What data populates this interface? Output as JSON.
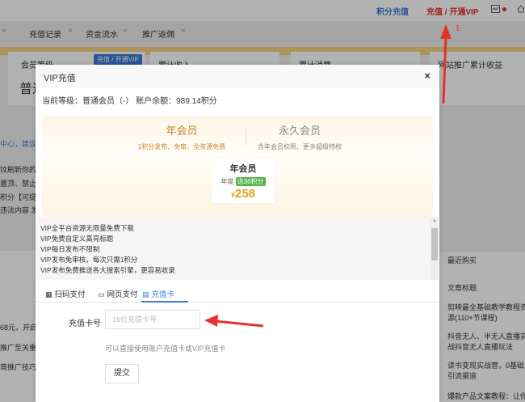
{
  "topbar": {
    "points_link": "积分充值",
    "vip_link": "充值 / 开通VIP"
  },
  "tabs": [
    {
      "label": "充值记录"
    },
    {
      "label": "资金流水"
    },
    {
      "label": "推广返佣"
    }
  ],
  "stats": {
    "member_level_label": "会员等级",
    "vip_badge": "充值 / 开通VIP",
    "cumulative_income_label": "累计收入",
    "cumulative_spend_label": "累计消费",
    "referral_label": "网站推广累计收益",
    "member_level_value": "普通"
  },
  "left_partial": [
    "中心，建议",
    "坟刷新你的认",
    "置顶、禁止重",
    "积分【可提",
    "违法内容 发"
  ],
  "left_lower": [
    "68元，开启",
    "推广至关重",
    "简推广技巧"
  ],
  "right_panel": {
    "heading1": "最近购买",
    "heading2": "文章标题",
    "items": [
      "剪映最全基础教学教程资源(110+节课程)",
      "抖音无人、半无人直播实战抖音无人直播玩法",
      "读书变现实战营，0基础引流渠道",
      "爆款产品文案教程：让你"
    ]
  },
  "modal": {
    "title": "VIP充值",
    "close": "×",
    "level_line": "当前等级：普通会员（-）  账户余额：989.14积分",
    "plans": {
      "annual": {
        "title": "年会员",
        "subtitle": "1积分发布、免审、全资源免费"
      },
      "forever": {
        "title": "永久会员",
        "subtitle": "含年会员权限、更多超级特权"
      },
      "card": {
        "name": "年会员",
        "period": "年度",
        "bonus": "送36积分",
        "currency": "¥",
        "price": "258"
      }
    },
    "benefits": [
      "VIP全平台资源无限量免费下载",
      "VIP免费自定义高亮标题",
      "VIP每日发布不限制",
      "VIP发布免审核，每次只需1积分",
      "VIP发布免费推送各大搜索引擎，更容易收录"
    ],
    "pay_tabs": [
      {
        "label": "扫码支付",
        "active": false
      },
      {
        "label": "网页支付",
        "active": false
      },
      {
        "label": "充值卡",
        "active": true
      }
    ],
    "card_form": {
      "label": "充值卡号",
      "placeholder": "16位充值卡号",
      "hint": "可以直接使用账户充值卡或VIP充值卡",
      "submit": "提交"
    }
  },
  "annotation": {
    "step_number": "1",
    "color": "#e5322d"
  }
}
